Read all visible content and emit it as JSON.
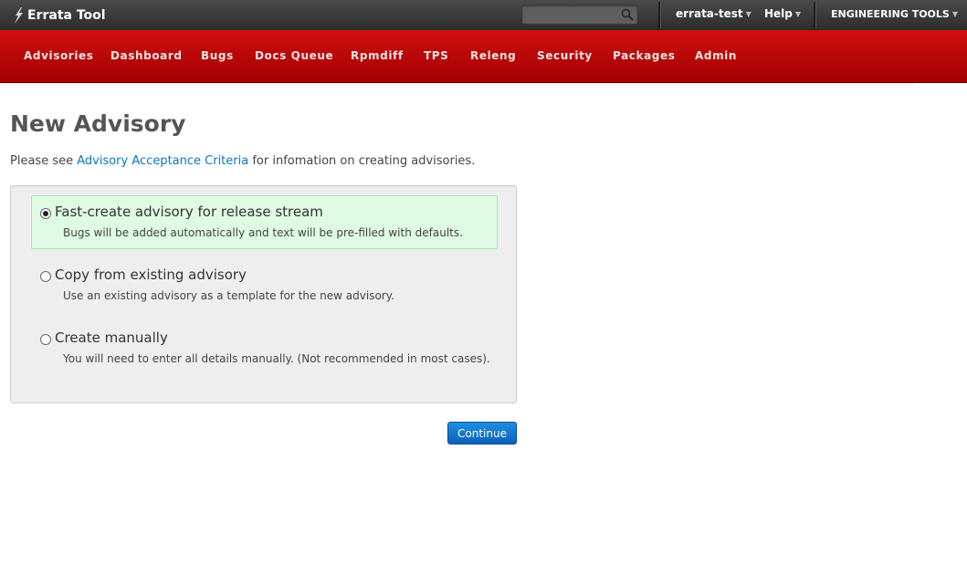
{
  "app": {
    "title": "Errata Tool"
  },
  "search": {
    "placeholder": "",
    "value": ""
  },
  "header_links": {
    "user": "errata-test",
    "help": "Help",
    "engineering": "ENGINEERING TOOLS"
  },
  "nav": {
    "items": [
      {
        "label": "Advisories"
      },
      {
        "label": "Dashboard"
      },
      {
        "label": "Bugs"
      },
      {
        "label": "Docs Queue"
      },
      {
        "label": "Rpmdiff"
      },
      {
        "label": "TPS"
      },
      {
        "label": "Releng"
      },
      {
        "label": "Security"
      },
      {
        "label": "Packages"
      },
      {
        "label": "Admin"
      }
    ]
  },
  "page": {
    "title": "New Advisory",
    "intro_before": "Please see",
    "intro_link": "Advisory Acceptance Criteria",
    "intro_after": "for infomation on creating advisories."
  },
  "options": [
    {
      "title": "Fast-create advisory for release stream",
      "desc": "Bugs will be added automatically and text will be pre-filled with defaults.",
      "selected": true
    },
    {
      "title": "Copy from existing advisory",
      "desc": "Use an existing advisory as a template for the new advisory.",
      "selected": false
    },
    {
      "title": "Create manually",
      "desc": "You will need to enter all details manually. (Not recommended in most cases).",
      "selected": false
    }
  ],
  "actions": {
    "continue_label": "Continue"
  },
  "colors": {
    "nav_red": "#c40a0a",
    "topbar": "#333333",
    "link": "#0a78c2",
    "selected_bg": "#dffbe3",
    "button_blue": "#1a7fd4"
  }
}
